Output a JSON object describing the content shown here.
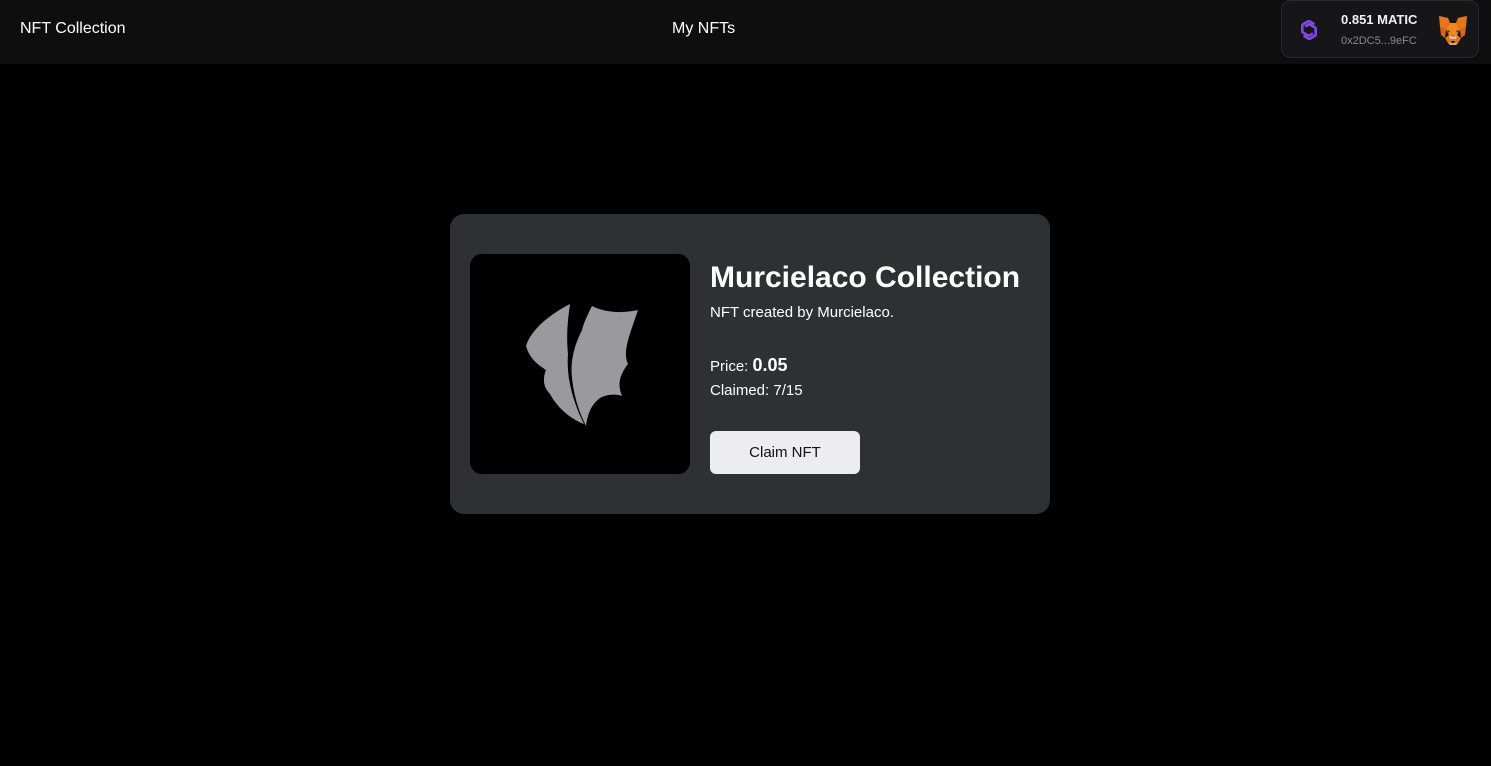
{
  "header": {
    "brand": "NFT Collection",
    "nav_link": "My NFTs",
    "wallet": {
      "chain_icon": "polygon-icon",
      "wallet_icon": "metamask-fox-icon",
      "balance": "0.851 MATIC",
      "address": "0x2DC5...9eFC",
      "chain_color": "#8247e5"
    }
  },
  "card": {
    "image_icon": "bat-wing-logo",
    "title": "Murcielaco Collection",
    "description": "NFT created by Murcielaco.",
    "price_label": "Price:",
    "price_value": "0.05",
    "claimed_label": "Claimed:",
    "claimed_value": "7/15",
    "claim_button": "Claim NFT"
  },
  "colors": {
    "background": "#000000",
    "topbar": "#0e0e0f",
    "card": "#2f3032",
    "button": "#ededef",
    "logo": "#9a9a9c"
  }
}
